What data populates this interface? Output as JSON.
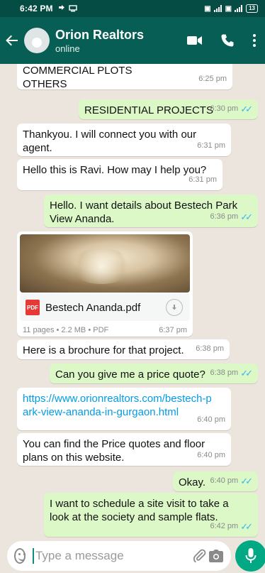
{
  "status_bar": {
    "time": "6:42 PM",
    "battery": "13"
  },
  "header": {
    "contact_name": "Orion Realtors",
    "contact_status": "online"
  },
  "messages": [
    {
      "dir": "in",
      "text": "COMMERCIAL PLOTS\nOTHERS",
      "time": "6:25 pm"
    },
    {
      "dir": "out",
      "text": "RESIDENTIAL PROJECTS",
      "time": "6:30 pm"
    },
    {
      "dir": "in",
      "text": "Thankyou. I will connect you with our agent.",
      "time": "6:31 pm"
    },
    {
      "dir": "in",
      "text": "Hello this is Ravi. How may I help you?",
      "time": "6:31 pm"
    },
    {
      "dir": "out",
      "text": "Hello. I want details about Bestech Park View Ananda.",
      "time": "6:36 pm"
    },
    {
      "dir": "in",
      "type": "document",
      "file_name": "Bestech Ananda.pdf",
      "file_icon": "PDF",
      "pages": "11 pages",
      "size": "2.2 MB",
      "kind": "PDF",
      "time": "6:37 pm"
    },
    {
      "dir": "in",
      "text": "Here is a brochure for that project.",
      "time": "6:38 pm"
    },
    {
      "dir": "out",
      "text": "Can you give me a price quote?",
      "time": "6:38 pm"
    },
    {
      "dir": "in",
      "text": "https://www.orionrealtors.com/bestech-park-view-ananda-in-gurgaon.html",
      "time": "6:40 pm"
    },
    {
      "dir": "in",
      "text": "You can find the Price quotes and floor plans on this website.",
      "time": "6:40 pm"
    },
    {
      "dir": "out",
      "text": "Okay.",
      "time": "6:40 pm"
    },
    {
      "dir": "out",
      "text": "I want to schedule a site visit to take a look at the society and sample flats.",
      "time": "6:42 pm"
    }
  ],
  "composer": {
    "placeholder": "Type a message"
  },
  "colors": {
    "header": "#075e54",
    "outgoing_bubble": "#dcf8c6",
    "incoming_bubble": "#ffffff",
    "read_ticks": "#34b7f1",
    "mic_button": "#00a884"
  }
}
